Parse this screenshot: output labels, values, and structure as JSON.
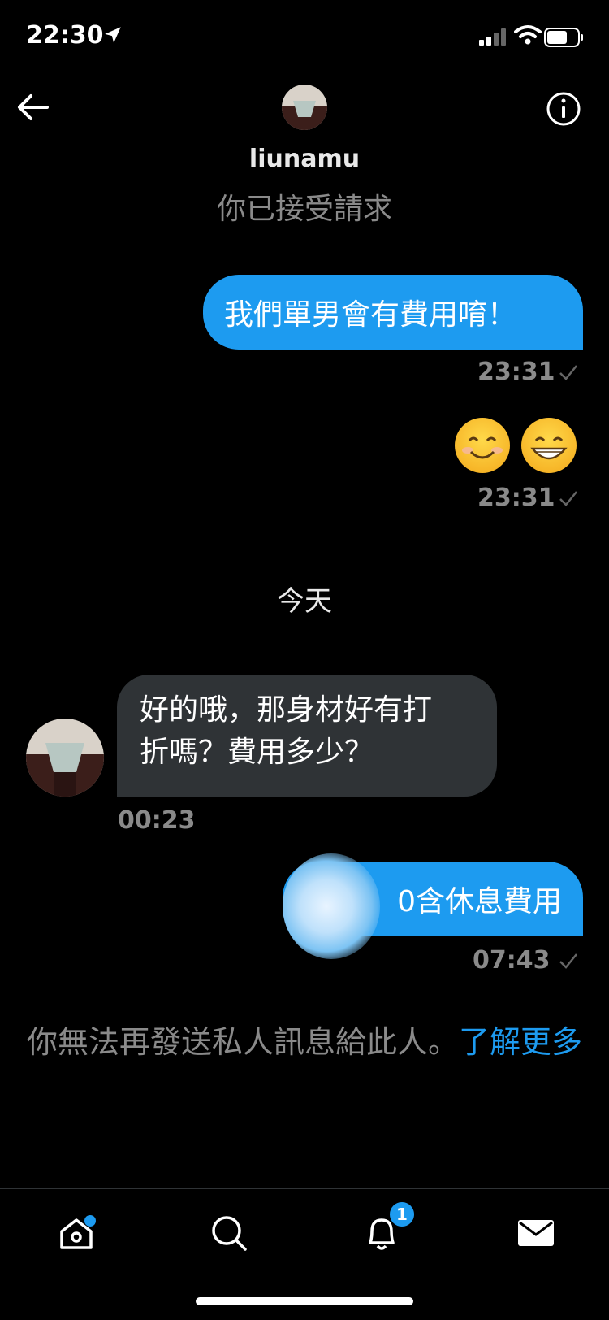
{
  "status_bar": {
    "time": "22:30"
  },
  "header": {
    "username": "liunamu",
    "subtitle": "你已接受請求"
  },
  "messages": [
    {
      "direction": "out",
      "text": "我們單男會有費用唷！",
      "time": "23:31"
    },
    {
      "direction": "out",
      "emoji": [
        "smiling-face",
        "grinning-face"
      ],
      "time": "23:31"
    },
    {
      "direction": "in",
      "text_lines": [
        "好的哦，那身材好有打",
        "折嗎？費用多少？"
      ],
      "time": "00:23"
    },
    {
      "direction": "out",
      "text": "0含休息費用",
      "time": "07:43"
    }
  ],
  "day_divider": "今天",
  "notice": {
    "text": "你無法再發送私人訊息給此人。",
    "link": "了解更多"
  },
  "tabbar": {
    "notifications_count": "1"
  },
  "colors": {
    "accent": "#1d9bf0",
    "incoming_bubble": "#2f3336",
    "muted": "#8a8a8a",
    "background": "#000000"
  }
}
